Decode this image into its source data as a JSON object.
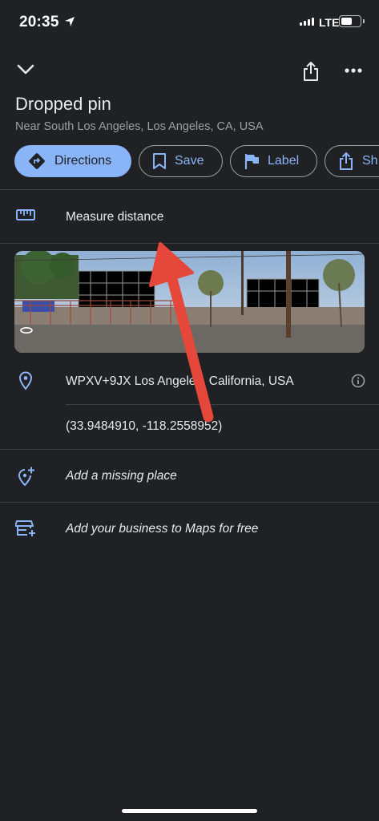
{
  "status_bar": {
    "time": "20:35",
    "network": "LTE"
  },
  "place": {
    "title": "Dropped pin",
    "subtitle": "Near South Los Angeles, Los Angeles, CA, USA"
  },
  "actions": [
    {
      "label": "Directions",
      "icon": "directions-icon"
    },
    {
      "label": "Save",
      "icon": "bookmark-icon"
    },
    {
      "label": "Label",
      "icon": "flag-icon"
    },
    {
      "label": "Share",
      "visible_text": "Sh",
      "icon": "share-icon"
    }
  ],
  "measure": {
    "label": "Measure distance",
    "icon": "ruler-icon"
  },
  "info": {
    "plus_code": "WPXV+9JX Los Angeles, California, USA",
    "coordinates": "(33.9484910, -118.2558952)"
  },
  "links": {
    "add_place": "Add a missing place",
    "add_business": "Add your business to Maps for free"
  },
  "colors": {
    "background": "#202124",
    "accent": "#8ab4f8",
    "annotation_arrow": "#e5473a"
  }
}
